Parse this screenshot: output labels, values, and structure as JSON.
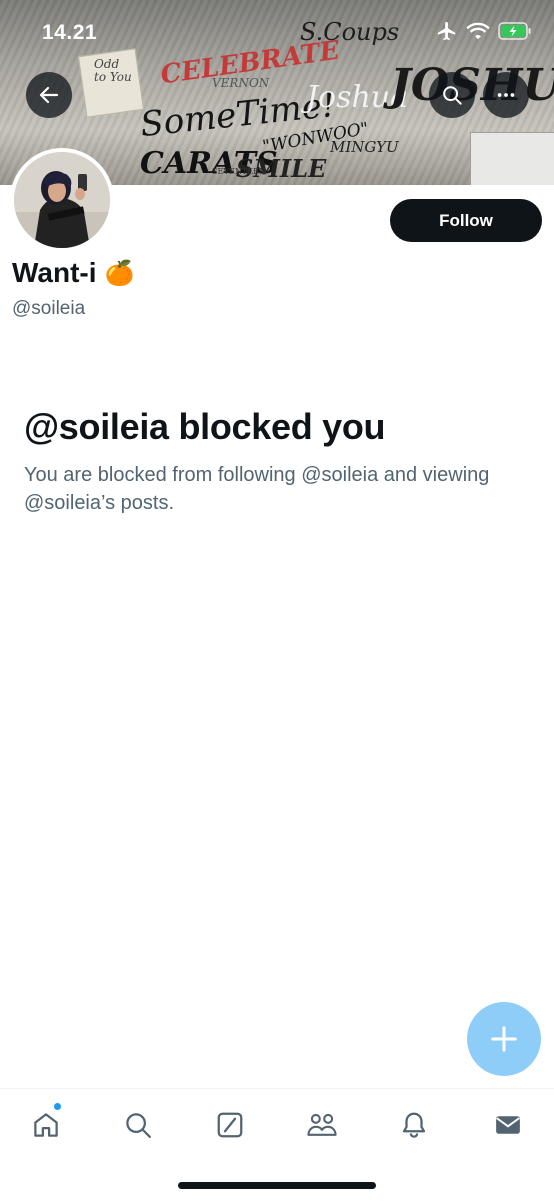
{
  "status_bar": {
    "time": "14.21"
  },
  "banner": {
    "graffiti": [
      "CELEBRATE",
      "S.Coups",
      "SomeTime!",
      "Joshua",
      "JOSHUA",
      "\"WONWOO\"",
      "CARATS",
      "SMILE",
      "VERNON",
      "MINGYU",
      "SEVENTEEN",
      "Odd to You"
    ]
  },
  "icons": {
    "back": "arrow-left-icon",
    "search": "search-icon",
    "more": "more-horizontal-icon",
    "compose": "plus-icon"
  },
  "profile": {
    "display_name": "Want-i",
    "emoji": "🍊",
    "handle": "@soileia",
    "follow_label": "Follow"
  },
  "blocked": {
    "title": "@soileia blocked you",
    "description": "You are blocked from following @soileia and viewing @soileia’s posts."
  },
  "tabbar": {
    "items": [
      "home-icon",
      "search-icon",
      "grok-icon",
      "communities-icon",
      "notifications-icon",
      "messages-icon"
    ],
    "notification_dot_color": "#1d9bf0"
  },
  "colors": {
    "accent": "#1d9bf0",
    "fab": "#8ecdf8",
    "text_primary": "#0f1419",
    "text_secondary": "#536471"
  }
}
